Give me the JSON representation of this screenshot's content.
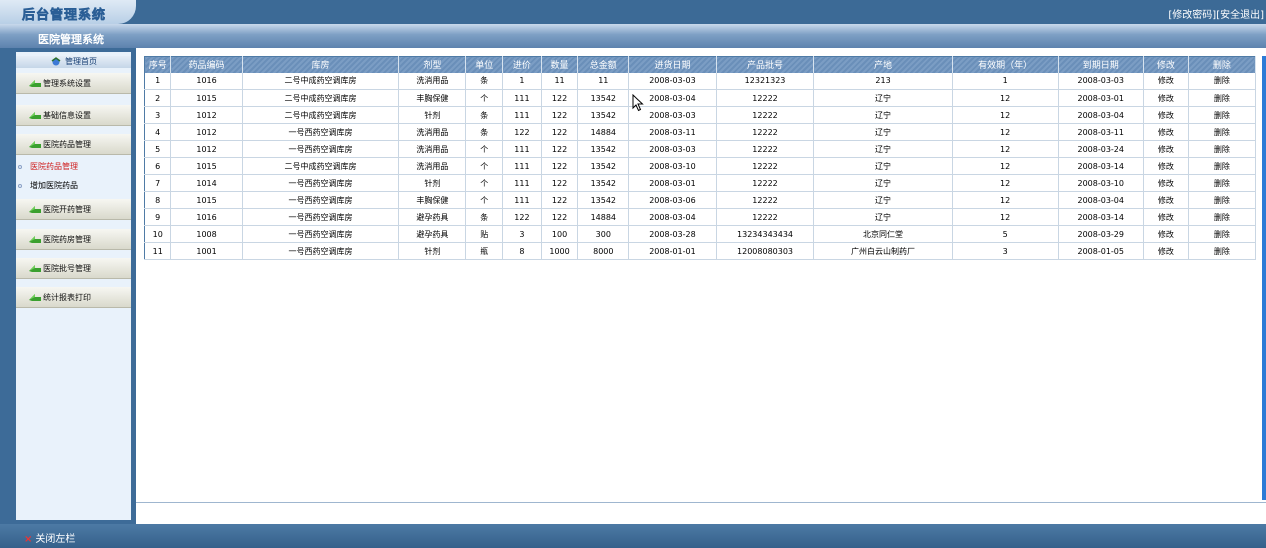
{
  "header": {
    "logo_text": "后台管理系统",
    "system_title": "医院管理系统",
    "links": [
      "[修改密码]",
      "[安全退出]"
    ]
  },
  "sidebar": {
    "home": "管理首页",
    "items": [
      "管理系统设置",
      "基础信息设置",
      "医院药品管理"
    ],
    "sub_items": [
      {
        "label": "医院药品管理",
        "active": true
      },
      {
        "label": "增加医院药品",
        "active": false
      }
    ],
    "items2": [
      "医院开药管理",
      "医院药房管理",
      "医院批号管理",
      "统计报表打印"
    ]
  },
  "table": {
    "headers": [
      "序号",
      "药品编码",
      "库房",
      "剂型",
      "单位",
      "进价",
      "数量",
      "总金额",
      "进货日期",
      "产品批号",
      "产地",
      "有效期（年）",
      "到期日期",
      "修改",
      "删除"
    ],
    "rows": [
      [
        "1",
        "1016",
        "二号中成药空调库房",
        "洗消用品",
        "条",
        "1",
        "11",
        "11",
        "2008-03-03",
        "12321323",
        "213",
        "1",
        "2008-03-03",
        "修改",
        "删除"
      ],
      [
        "2",
        "1015",
        "二号中成药空调库房",
        "丰胸保健",
        "个",
        "111",
        "122",
        "13542",
        "2008-03-04",
        "12222",
        "辽宁",
        "12",
        "2008-03-01",
        "修改",
        "删除"
      ],
      [
        "3",
        "1012",
        "二号中成药空调库房",
        "针剂",
        "条",
        "111",
        "122",
        "13542",
        "2008-03-03",
        "12222",
        "辽宁",
        "12",
        "2008-03-04",
        "修改",
        "删除"
      ],
      [
        "4",
        "1012",
        "一号西药空调库房",
        "洗消用品",
        "条",
        "122",
        "122",
        "14884",
        "2008-03-11",
        "12222",
        "辽宁",
        "12",
        "2008-03-11",
        "修改",
        "删除"
      ],
      [
        "5",
        "1012",
        "一号西药空调库房",
        "洗消用品",
        "个",
        "111",
        "122",
        "13542",
        "2008-03-03",
        "12222",
        "辽宁",
        "12",
        "2008-03-24",
        "修改",
        "删除"
      ],
      [
        "6",
        "1015",
        "二号中成药空调库房",
        "洗消用品",
        "个",
        "111",
        "122",
        "13542",
        "2008-03-10",
        "12222",
        "辽宁",
        "12",
        "2008-03-14",
        "修改",
        "删除"
      ],
      [
        "7",
        "1014",
        "一号西药空调库房",
        "针剂",
        "个",
        "111",
        "122",
        "13542",
        "2008-03-01",
        "12222",
        "辽宁",
        "12",
        "2008-03-10",
        "修改",
        "删除"
      ],
      [
        "8",
        "1015",
        "一号西药空调库房",
        "丰胸保健",
        "个",
        "111",
        "122",
        "13542",
        "2008-03-06",
        "12222",
        "辽宁",
        "12",
        "2008-03-04",
        "修改",
        "删除"
      ],
      [
        "9",
        "1016",
        "一号西药空调库房",
        "避孕药具",
        "条",
        "122",
        "122",
        "14884",
        "2008-03-04",
        "12222",
        "辽宁",
        "12",
        "2008-03-14",
        "修改",
        "删除"
      ],
      [
        "10",
        "1008",
        "一号西药空调库房",
        "避孕药具",
        "贴",
        "3",
        "100",
        "300",
        "2008-03-28",
        "13234343434",
        "北京同仁堂",
        "5",
        "2008-03-29",
        "修改",
        "删除"
      ],
      [
        "11",
        "1001",
        "一号西药空调库房",
        "针剂",
        "瓶",
        "8",
        "1000",
        "8000",
        "2008-01-01",
        "12008080303",
        "广州白云山制药厂",
        "3",
        "2008-01-05",
        "修改",
        "删除"
      ]
    ]
  },
  "footer": {
    "close_left": "关闭左栏"
  },
  "colors": {
    "bar": "#3c6a96",
    "header_cell": "#7b9dc4",
    "active_sub": "#d02020",
    "sidebar_bg": "#e9f2fb"
  },
  "icons": {
    "home": "home-icon",
    "menu": "green-arrow-icon",
    "sub": "circle-bullet-icon",
    "close": "close-x-icon"
  }
}
